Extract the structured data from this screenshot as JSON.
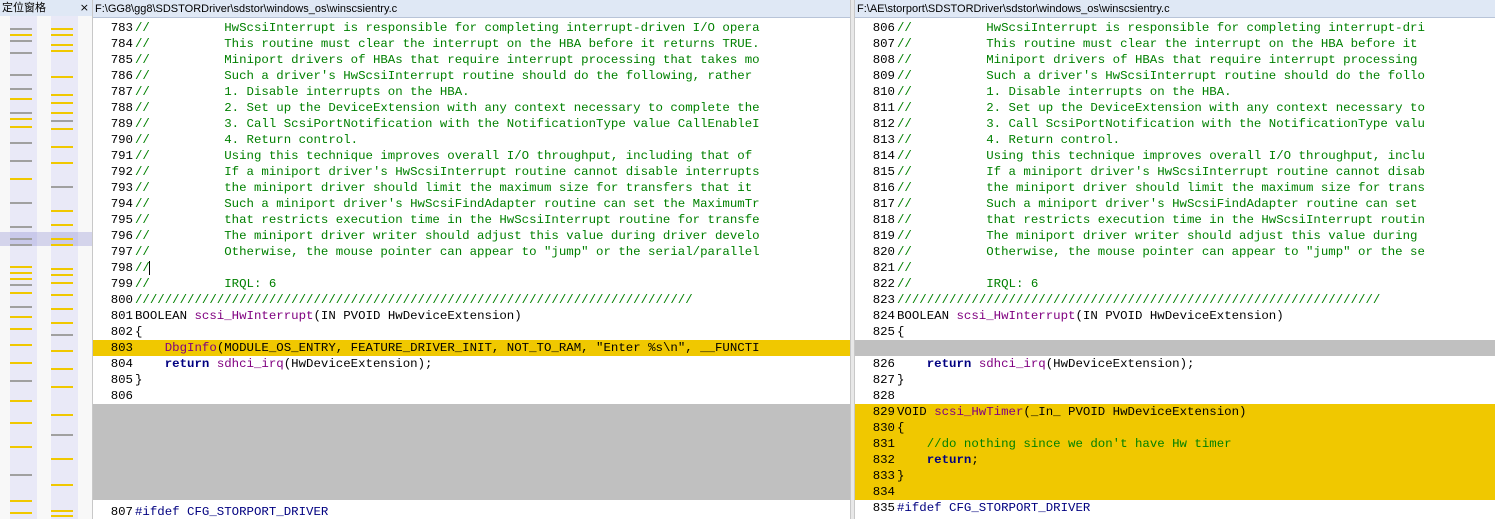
{
  "locator": {
    "title": "定位窗格",
    "close": "×"
  },
  "left": {
    "path": "F:\\GG8\\gg8\\SDSTORDriver\\sdstor\\windows_os\\winscsientry.c",
    "lines": [
      {
        "n": "783",
        "t": "//          HwScsiInterrupt is responsible for completing interrupt-driven I/O opera"
      },
      {
        "n": "784",
        "t": "//          This routine must clear the interrupt on the HBA before it returns TRUE."
      },
      {
        "n": "785",
        "t": "//          Miniport drivers of HBAs that require interrupt processing that takes mo"
      },
      {
        "n": "786",
        "t": "//          Such a driver's HwScsiInterrupt routine should do the following, rather "
      },
      {
        "n": "787",
        "t": "//          1. Disable interrupts on the HBA."
      },
      {
        "n": "788",
        "t": "//          2. Set up the DeviceExtension with any context necessary to complete the"
      },
      {
        "n": "789",
        "t": "//          3. Call ScsiPortNotification with the NotificationType value CallEnableI"
      },
      {
        "n": "790",
        "t": "//          4. Return control."
      },
      {
        "n": "791",
        "t": "//          Using this technique improves overall I/O throughput, including that of "
      },
      {
        "n": "792",
        "t": "//          If a miniport driver's HwScsiInterrupt routine cannot disable interrupts"
      },
      {
        "n": "793",
        "t": "//          the miniport driver should limit the maximum size for transfers that it "
      },
      {
        "n": "794",
        "t": "//          Such a miniport driver's HwScsiFindAdapter routine can set the MaximumTr"
      },
      {
        "n": "795",
        "t": "//          that restricts execution time in the HwScsiInterrupt routine for transfe"
      },
      {
        "n": "796",
        "t": "//          The miniport driver writer should adjust this value during driver develo"
      },
      {
        "n": "797",
        "t": "//          Otherwise, the mouse pointer can appear to \"jump\" or the serial/parallel"
      },
      {
        "n": "798",
        "t": "//"
      },
      {
        "n": "799",
        "t": "//          IRQL: 6"
      },
      {
        "n": "800",
        "t": "///////////////////////////////////////////////////////////////////////////"
      },
      {
        "n": "801",
        "t": "BOOLEAN scsi_HwInterrupt(IN PVOID HwDeviceExtension)"
      },
      {
        "n": "802",
        "t": "{"
      },
      {
        "n": "803",
        "t": "    DbgInfo(MODULE_OS_ENTRY, FEATURE_DRIVER_INIT, NOT_TO_RAM, \"Enter %s\\n\", __FUNCTI"
      },
      {
        "n": "804",
        "t": "    return sdhci_irq(HwDeviceExtension);"
      },
      {
        "n": "805",
        "t": "}"
      },
      {
        "n": "806",
        "t": ""
      },
      {
        "n": "807",
        "t": "#ifdef CFG_STORPORT_DRIVER"
      }
    ]
  },
  "right": {
    "path": "F:\\AE\\storport\\SDSTORDriver\\sdstor\\windows_os\\winscsientry.c",
    "lines": [
      {
        "n": "806",
        "t": "//          HwScsiInterrupt is responsible for completing interrupt-dri"
      },
      {
        "n": "807",
        "t": "//          This routine must clear the interrupt on the HBA before it "
      },
      {
        "n": "808",
        "t": "//          Miniport drivers of HBAs that require interrupt processing "
      },
      {
        "n": "809",
        "t": "//          Such a driver's HwScsiInterrupt routine should do the follo"
      },
      {
        "n": "810",
        "t": "//          1. Disable interrupts on the HBA."
      },
      {
        "n": "811",
        "t": "//          2. Set up the DeviceExtension with any context necessary to"
      },
      {
        "n": "812",
        "t": "//          3. Call ScsiPortNotification with the NotificationType valu"
      },
      {
        "n": "813",
        "t": "//          4. Return control."
      },
      {
        "n": "814",
        "t": "//          Using this technique improves overall I/O throughput, inclu"
      },
      {
        "n": "815",
        "t": "//          If a miniport driver's HwScsiInterrupt routine cannot disab"
      },
      {
        "n": "816",
        "t": "//          the miniport driver should limit the maximum size for trans"
      },
      {
        "n": "817",
        "t": "//          Such a miniport driver's HwScsiFindAdapter routine can set "
      },
      {
        "n": "818",
        "t": "//          that restricts execution time in the HwScsiInterrupt routin"
      },
      {
        "n": "819",
        "t": "//          The miniport driver writer should adjust this value during "
      },
      {
        "n": "820",
        "t": "//          Otherwise, the mouse pointer can appear to \"jump\" or the se"
      },
      {
        "n": "821",
        "t": "//"
      },
      {
        "n": "822",
        "t": "//          IRQL: 6"
      },
      {
        "n": "823",
        "t": "/////////////////////////////////////////////////////////////////"
      },
      {
        "n": "824",
        "t": "BOOLEAN scsi_HwInterrupt(IN PVOID HwDeviceExtension)"
      },
      {
        "n": "825",
        "t": "{"
      },
      {
        "n": "",
        "t": ""
      },
      {
        "n": "826",
        "t": "    return sdhci_irq(HwDeviceExtension);"
      },
      {
        "n": "827",
        "t": "}"
      },
      {
        "n": "828",
        "t": ""
      },
      {
        "n": "829",
        "t": "VOID scsi_HwTimer(_In_ PVOID HwDeviceExtension)"
      },
      {
        "n": "830",
        "t": "{"
      },
      {
        "n": "831",
        "t": "    //do nothing since we don't have Hw timer"
      },
      {
        "n": "832",
        "t": "    return;"
      },
      {
        "n": "833",
        "t": "}"
      },
      {
        "n": "834",
        "t": ""
      },
      {
        "n": "835",
        "t": "#ifdef CFG_STORPORT_DRIVER"
      }
    ]
  },
  "colors": {
    "highlight": "#f0c800",
    "gap": "#c0c0c0",
    "comment": "#008000",
    "function": "#800080"
  }
}
